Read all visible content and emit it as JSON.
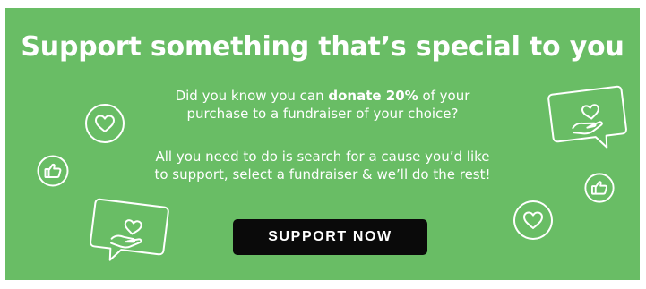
{
  "banner": {
    "title": "Support something that’s special to you",
    "intro_before": "Did you know you can ",
    "intro_bold": "donate 20%",
    "intro_after": " of your purchase to a fundraiser of your choice?",
    "instructions": "All you need to do is search for a cause you’d like to support, select a fundraiser & we’ll do the rest!",
    "cta_label": "SUPPORT NOW"
  },
  "icons": [
    "heart-circle-icon",
    "thumbs-up-circle-icon",
    "heart-hand-speech-bubble-icon",
    "heart-hand-speech-bubble-icon",
    "thumbs-up-circle-icon",
    "heart-circle-icon"
  ],
  "colors": {
    "background": "#69bd65",
    "text": "#ffffff",
    "button": "#0a0a0a",
    "button_text": "#ffffff",
    "page": "#ffffff"
  }
}
